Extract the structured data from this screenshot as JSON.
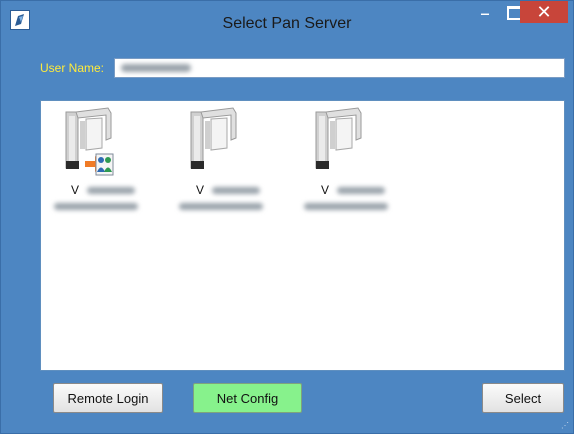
{
  "window": {
    "title": "Select Pan Server"
  },
  "user": {
    "label": "User Name:",
    "value": ""
  },
  "servers": [
    {
      "prefix": "V",
      "selected": true,
      "badge_icon": "remote-users-badge-icon"
    },
    {
      "prefix": "V",
      "selected": false
    },
    {
      "prefix": "V",
      "selected": false
    }
  ],
  "buttons": {
    "remote_login": "Remote Login",
    "net_config": "Net Config",
    "select": "Select"
  },
  "colors": {
    "window_bg": "#4d86c2",
    "close_btn": "#c8453a",
    "user_label": "#ffeb3b",
    "net_config_bg": "#87f28c"
  }
}
